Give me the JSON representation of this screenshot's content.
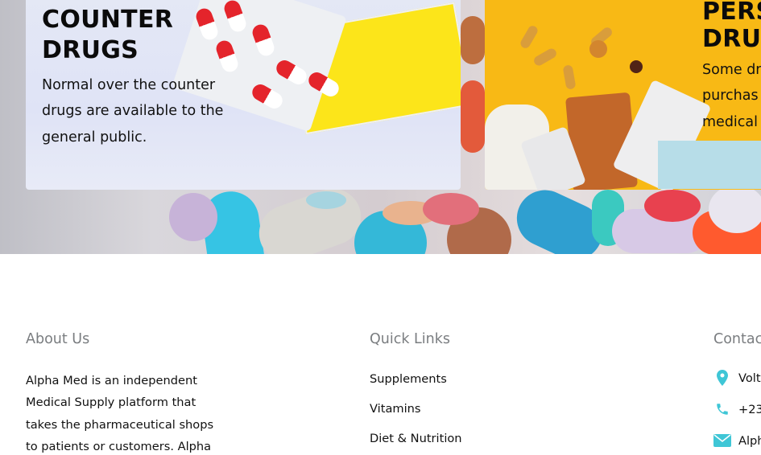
{
  "hero": {
    "cards": [
      {
        "title_line1": "COUNTER",
        "title_line2": "DRUGS",
        "text_line1": "Normal over the counter",
        "text_line2": "drugs are available to the",
        "text_line3": "general public."
      },
      {
        "title_line1": "PERS",
        "title_line2": "DRUG",
        "text_line1": "Some dr",
        "text_line2": "purchas",
        "text_line3": "medical"
      }
    ]
  },
  "footer": {
    "about": {
      "title": "About Us",
      "lines": [
        "Alpha Med is an independent",
        "Medical Supply platform that",
        "takes the pharmaceutical shops",
        "to patients or customers. Alpha"
      ]
    },
    "quick_links": {
      "title": "Quick Links",
      "links": [
        "Supplements",
        "Vitamins",
        "Diet & Nutrition"
      ]
    },
    "contact": {
      "title": "Contac",
      "items": [
        {
          "icon": "location-pin-icon",
          "text": "Volt"
        },
        {
          "icon": "phone-icon",
          "text": "+23"
        },
        {
          "icon": "envelope-icon",
          "text": "Alph"
        }
      ],
      "accent_color": "#3fc6d6"
    }
  }
}
